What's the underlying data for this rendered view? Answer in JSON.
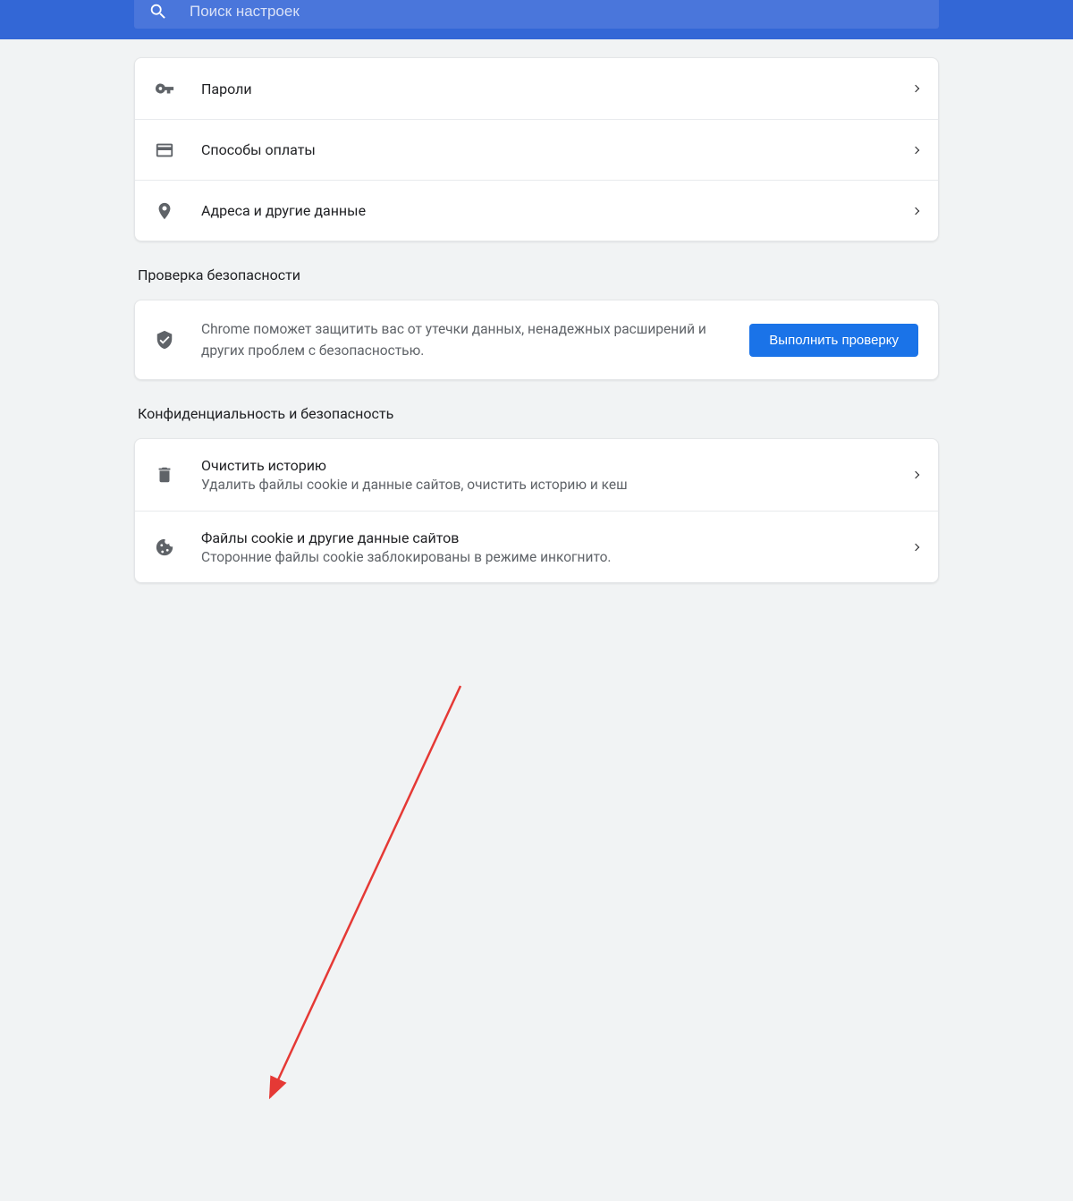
{
  "search": {
    "placeholder": "Поиск настроек"
  },
  "autofill": {
    "passwords": "Пароли",
    "payment": "Способы оплаты",
    "addresses": "Адреса и другие данные"
  },
  "safety": {
    "heading": "Проверка безопасности",
    "description": "Chrome поможет защитить вас от утечки данных, ненадежных расширений и других проблем с безопасностью.",
    "button": "Выполнить проверку"
  },
  "privacy": {
    "heading": "Конфиденциальность и безопасность",
    "clear_title": "Очистить историю",
    "clear_sub": "Удалить файлы cookie и данные сайтов, очистить историю и кеш",
    "cookies_title": "Файлы cookie и другие данные сайтов",
    "cookies_sub": "Сторонние файлы cookie заблокированы в режиме инкогнито."
  }
}
